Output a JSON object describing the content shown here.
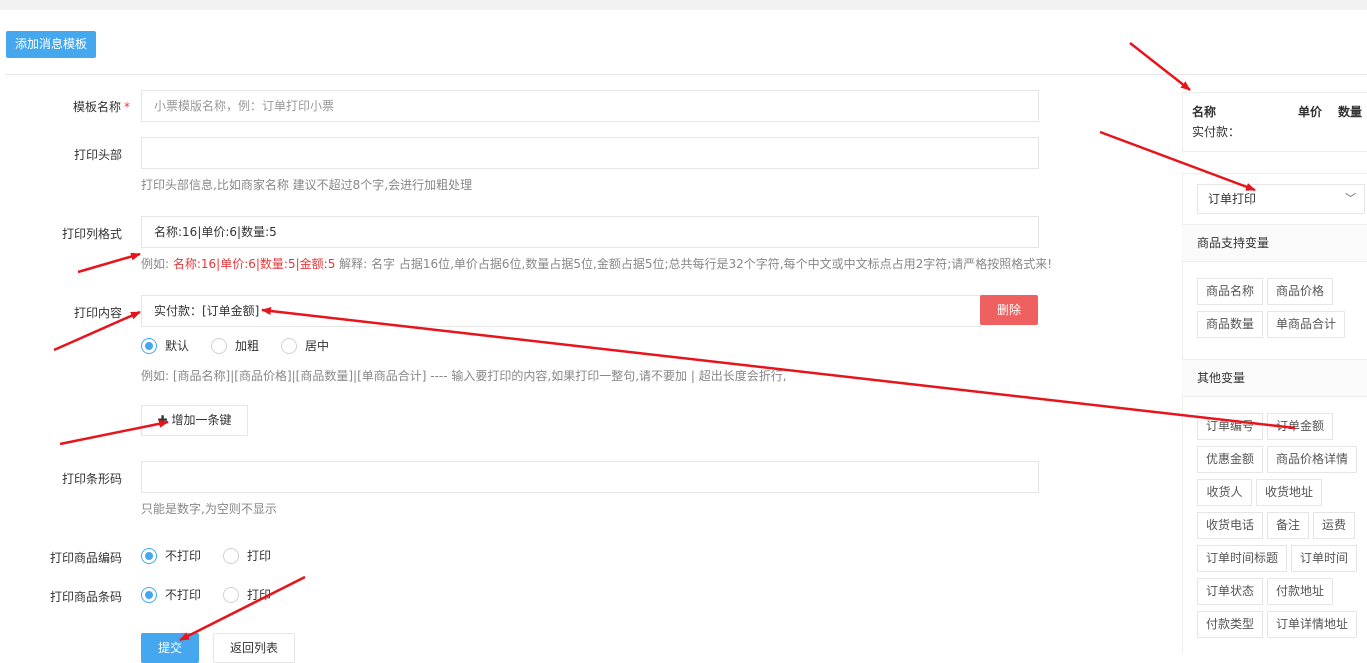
{
  "header": {
    "add_button": "添加消息模板"
  },
  "form": {
    "template_name": {
      "label": "模板名称",
      "required": "*",
      "placeholder": "小票模版名称，例：订单打印小票"
    },
    "print_header": {
      "label": "打印头部",
      "value": "",
      "hint": "打印头部信息,比如商家名称 建议不超过8个字,会进行加粗处理"
    },
    "column_format": {
      "label": "打印列格式",
      "value": "名称:16|单价:6|数量:5",
      "hint_prefix": "例如: ",
      "hint_example": "名称:16|单价:6|数量:5|金额:5",
      "hint_rest": " 解释: 名字 占据16位,单价占据6位,数量占据5位,金额占据5位;总共每行是32个字符,每个中文或中文标点占用2字符;请严格按照格式来!"
    },
    "print_content": {
      "label": "打印内容",
      "value": "实付款：[订单金额]",
      "delete_button": "删除",
      "options": [
        "默认",
        "加粗",
        "居中"
      ],
      "selected": 0,
      "hint": "例如: [商品名称]|[商品价格]|[商品数量]|[单商品合计] ---- 输入要打印的内容,如果打印一整句,请不要加 | 超出长度会折行,"
    },
    "add_key_button": "增加一条键",
    "barcode": {
      "label": "打印条形码",
      "value": "",
      "hint": "只能是数字,为空则不显示"
    },
    "product_code": {
      "label": "打印商品编码",
      "options": [
        "不打印",
        "打印"
      ],
      "selected": 0
    },
    "product_barcode": {
      "label": "打印商品条码",
      "options": [
        "不打印",
        "打印"
      ],
      "selected": 0
    },
    "submit_button": "提交",
    "back_button": "返回列表"
  },
  "preview": {
    "col_name": "名称",
    "col_price": "单价",
    "col_qty": "数量",
    "pay_line": "实付款："
  },
  "sidebar": {
    "select_value": "订单打印",
    "goods_vars_title": "商品支持变量",
    "goods_vars": [
      "商品名称",
      "商品价格",
      "商品数量",
      "单商品合计"
    ],
    "other_vars_title": "其他变量",
    "other_vars": [
      "订单编号",
      "订单金额",
      "优惠金额",
      "商品价格详情",
      "收货人",
      "收货地址",
      "收货电话",
      "备注",
      "运费",
      "订单时间标题",
      "订单时间",
      "订单状态",
      "付款地址",
      "付款类型",
      "订单详情地址"
    ]
  },
  "colors": {
    "primary": "#45a8ee",
    "danger": "#ef6060",
    "annotation_arrow": "#e8141b"
  }
}
